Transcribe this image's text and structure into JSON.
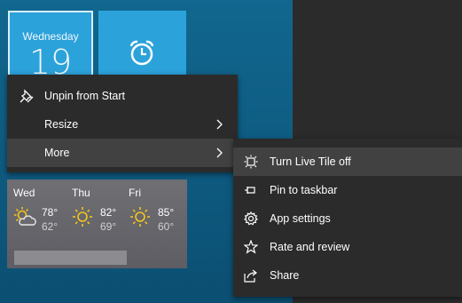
{
  "calendar_tile": {
    "weekday": "Wednesday",
    "date": "19"
  },
  "alarm_tile": {
    "icon": "alarm-clock-icon"
  },
  "context_menu": {
    "items": [
      {
        "label": "Unpin from Start",
        "icon": "unpin-icon"
      },
      {
        "label": "Resize",
        "icon": "chevron-right-icon"
      },
      {
        "label": "More",
        "icon": "chevron-right-icon"
      }
    ]
  },
  "submenu": {
    "items": [
      {
        "label": "Turn Live Tile off",
        "icon": "live-tile-icon"
      },
      {
        "label": "Pin to taskbar",
        "icon": "pin-icon"
      },
      {
        "label": "App settings",
        "icon": "gear-icon"
      },
      {
        "label": "Rate and review",
        "icon": "star-icon"
      },
      {
        "label": "Share",
        "icon": "share-icon"
      }
    ]
  },
  "weather_tile": {
    "days": [
      {
        "day": "Wed",
        "high": "78°",
        "low": "62°",
        "icon": "partly-cloudy-icon"
      },
      {
        "day": "Thu",
        "high": "82°",
        "low": "69°",
        "icon": "sun-icon"
      },
      {
        "day": "Fri",
        "high": "85°",
        "low": "60°",
        "icon": "sun-icon"
      }
    ]
  },
  "colors": {
    "desktop_blue": "#0f5f86",
    "tile_blue": "#2ca2da",
    "menu_bg": "#2b2b2b",
    "menu_highlight": "#414141",
    "sun_yellow": "#f5c518"
  }
}
